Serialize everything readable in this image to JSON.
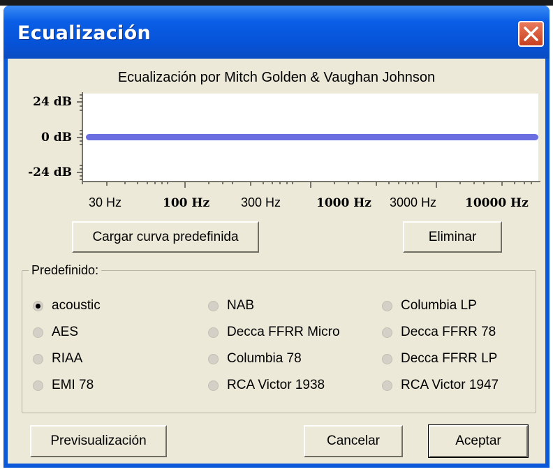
{
  "window": {
    "title": "Ecualización"
  },
  "header": {
    "subtitle": "Ecualización por Mitch Golden & Vaughan Johnson"
  },
  "graph": {
    "y_labels": [
      "24 dB",
      "0 dB",
      "-24 dB"
    ],
    "x_labels": [
      "30 Hz",
      "100 Hz",
      "300 Hz",
      "1000 Hz",
      "3000 Hz",
      "10000 Hz"
    ],
    "curve_color": "#6a6ee0",
    "curve_level_db": 0
  },
  "actions": {
    "load_curve": "Cargar curva predefinida",
    "delete": "Eliminar"
  },
  "presets": {
    "legend": "Predefinido:",
    "selected": "acoustic",
    "items": [
      "acoustic",
      "NAB",
      "Columbia LP",
      "AES",
      "Decca FFRR Micro",
      "Decca FFRR 78",
      "RIAA",
      "Columbia 78",
      "Decca FFRR LP",
      "EMI 78",
      "RCA Victor 1938",
      "RCA Victor 1947"
    ]
  },
  "footer": {
    "preview": "Previsualización",
    "cancel": "Cancelar",
    "accept": "Aceptar"
  },
  "colors": {
    "titlebar": "#0a5ee6",
    "close": "#c8401f",
    "client": "#ece9d8"
  }
}
